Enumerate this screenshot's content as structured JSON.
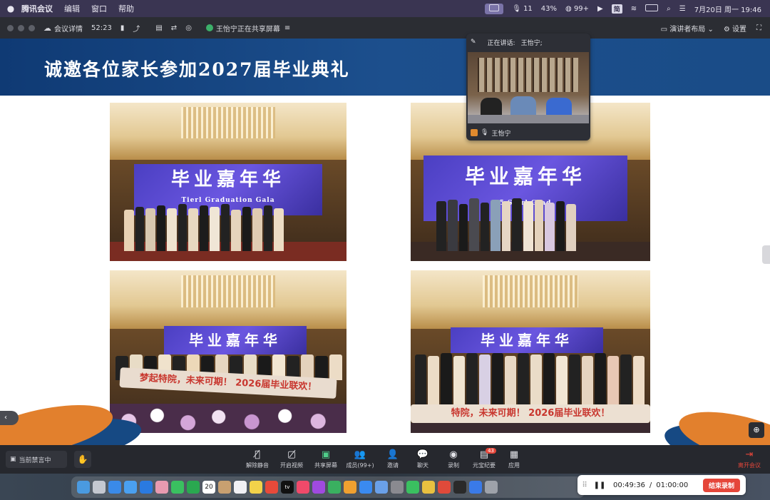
{
  "menubar": {
    "app_name": "腾讯会议",
    "items": [
      "编辑",
      "窗口",
      "帮助"
    ],
    "status": {
      "mic_count": "11",
      "battery": "43%",
      "wechat_count": "99+",
      "date_time": "7月20日 周一  19:46"
    }
  },
  "meeting_toolbar": {
    "details_label": "会议详情",
    "duration": "52:23",
    "sharing_text": "王怡宁正在共享屏幕",
    "layout_label": "演讲者布局",
    "settings_label": "设置"
  },
  "slide": {
    "title": "诚邀各位家长参加2027届毕业典礼",
    "photos": [
      {
        "screen_text": "毕业嘉年华",
        "screen_sub": "Tierl Graduation Gala"
      },
      {
        "screen_text": "毕业嘉年华",
        "screen_sub": "5 Sierl Grad"
      },
      {
        "screen_text": "毕业嘉年华",
        "banner": "梦起特院，未来可期！ 2026届毕业联欢！"
      },
      {
        "screen_text": "毕业嘉年华",
        "banner": "特院，未来可期！ 2026届毕业联欢！"
      }
    ]
  },
  "video": {
    "speaking_label": "正在讲话:",
    "speaker": "王怡宁;",
    "participant_name": "王怡宁"
  },
  "bottom_toolbar": {
    "status_label": "当前禁言中",
    "buttons": [
      {
        "label": "解除静音",
        "icon": "mic-off-icon"
      },
      {
        "label": "开启视频",
        "icon": "video-off-icon"
      },
      {
        "label": "共享屏幕",
        "icon": "share-screen-icon"
      },
      {
        "label": "成员(99+)",
        "icon": "members-icon"
      },
      {
        "label": "邀请",
        "icon": "invite-icon"
      },
      {
        "label": "聊天",
        "icon": "chat-icon"
      },
      {
        "label": "录制",
        "icon": "record-icon"
      },
      {
        "label": "元宝纪要",
        "icon": "summary-icon",
        "badge": "43"
      },
      {
        "label": "应用",
        "icon": "apps-icon"
      }
    ],
    "leave_label": "离开会议"
  },
  "recording": {
    "elapsed": "00:49:36",
    "separator": "/",
    "limit": "01:00:00",
    "stop_label": "结束录制"
  },
  "dock": {
    "calendar_day": "20",
    "tv_label": "tv"
  }
}
